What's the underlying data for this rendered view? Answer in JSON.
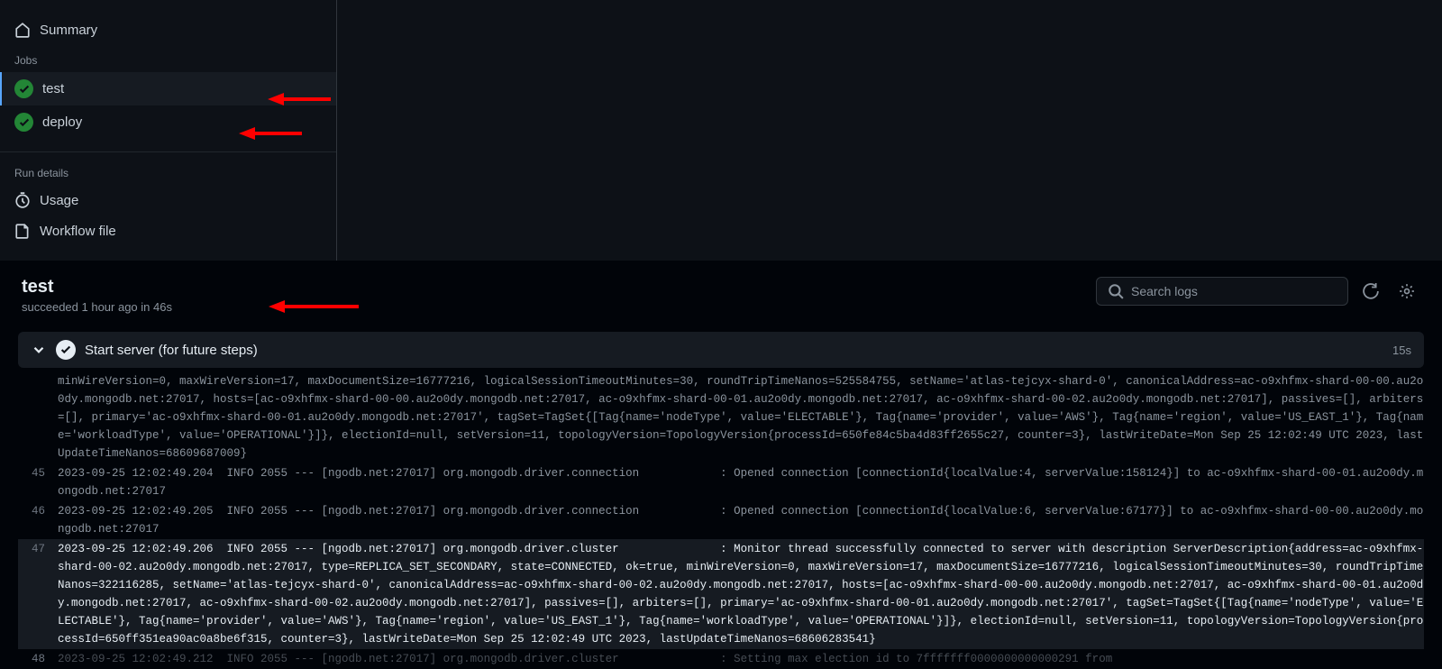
{
  "sidebar": {
    "summary_label": "Summary",
    "jobs_heading": "Jobs",
    "jobs": [
      {
        "label": "test",
        "selected": true
      },
      {
        "label": "deploy",
        "selected": false
      }
    ],
    "rundetails_heading": "Run details",
    "usage_label": "Usage",
    "workflow_label": "Workflow file"
  },
  "header": {
    "title": "test",
    "subtitle": "succeeded 1 hour ago in 46s",
    "search_placeholder": "Search logs"
  },
  "step": {
    "title": "Start server (for future steps)",
    "duration": "15s"
  },
  "logs": [
    {
      "num": "",
      "text": "minWireVersion=0, maxWireVersion=17, maxDocumentSize=16777216, logicalSessionTimeoutMinutes=30, roundTripTimeNanos=525584755, setName='atlas-tejcyx-shard-0', canonicalAddress=ac-o9xhfmx-shard-00-00.au2o0dy.mongodb.net:27017, hosts=[ac-o9xhfmx-shard-00-00.au2o0dy.mongodb.net:27017, ac-o9xhfmx-shard-00-01.au2o0dy.mongodb.net:27017, ac-o9xhfmx-shard-00-02.au2o0dy.mongodb.net:27017], passives=[], arbiters=[], primary='ac-o9xhfmx-shard-00-01.au2o0dy.mongodb.net:27017', tagSet=TagSet{[Tag{name='nodeType', value='ELECTABLE'}, Tag{name='provider', value='AWS'}, Tag{name='region', value='US_EAST_1'}, Tag{name='workloadType', value='OPERATIONAL'}]}, electionId=null, setVersion=11, topologyVersion=TopologyVersion{processId=650fe84c5ba4d83ff2655c27, counter=3}, lastWriteDate=Mon Sep 25 12:02:49 UTC 2023, lastUpdateTimeNanos=68609687009}",
      "highlight": false
    },
    {
      "num": "45",
      "text": "2023-09-25 12:02:49.204  INFO 2055 --- [ngodb.net:27017] org.mongodb.driver.connection            : Opened connection [connectionId{localValue:4, serverValue:158124}] to ac-o9xhfmx-shard-00-01.au2o0dy.mongodb.net:27017",
      "highlight": false
    },
    {
      "num": "46",
      "text": "2023-09-25 12:02:49.205  INFO 2055 --- [ngodb.net:27017] org.mongodb.driver.connection            : Opened connection [connectionId{localValue:6, serverValue:67177}] to ac-o9xhfmx-shard-00-00.au2o0dy.mongodb.net:27017",
      "highlight": false
    },
    {
      "num": "47",
      "text": "2023-09-25 12:02:49.206  INFO 2055 --- [ngodb.net:27017] org.mongodb.driver.cluster               : Monitor thread successfully connected to server with description ServerDescription{address=ac-o9xhfmx-shard-00-02.au2o0dy.mongodb.net:27017, type=REPLICA_SET_SECONDARY, state=CONNECTED, ok=true, minWireVersion=0, maxWireVersion=17, maxDocumentSize=16777216, logicalSessionTimeoutMinutes=30, roundTripTimeNanos=322116285, setName='atlas-tejcyx-shard-0', canonicalAddress=ac-o9xhfmx-shard-00-02.au2o0dy.mongodb.net:27017, hosts=[ac-o9xhfmx-shard-00-00.au2o0dy.mongodb.net:27017, ac-o9xhfmx-shard-00-01.au2o0dy.mongodb.net:27017, ac-o9xhfmx-shard-00-02.au2o0dy.mongodb.net:27017], passives=[], arbiters=[], primary='ac-o9xhfmx-shard-00-01.au2o0dy.mongodb.net:27017', tagSet=TagSet{[Tag{name='nodeType', value='ELECTABLE'}, Tag{name='provider', value='AWS'}, Tag{name='region', value='US_EAST_1'}, Tag{name='workloadType', value='OPERATIONAL'}]}, electionId=null, setVersion=11, topologyVersion=TopologyVersion{processId=650ff351ea90ac0a8be6f315, counter=3}, lastWriteDate=Mon Sep 25 12:02:49 UTC 2023, lastUpdateTimeNanos=68606283541}",
      "highlight": true
    },
    {
      "num": "48",
      "text": "2023-09-25 12:02:49.212  INFO 2055 --- [ngodb.net:27017] org.mongodb.driver.cluster               : Setting max election id to 7fffffff0000000000000291 from",
      "highlight": false,
      "fade": true
    }
  ]
}
